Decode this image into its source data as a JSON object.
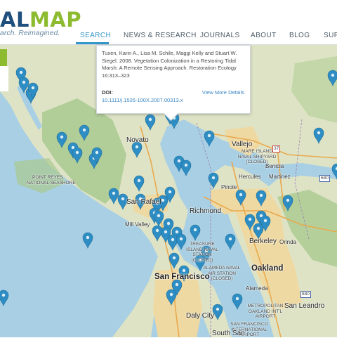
{
  "logo": {
    "text_dark": "AL",
    "text_accent": "MAP",
    "tagline": "arch. Reimagined."
  },
  "nav": {
    "search": "SEARCH",
    "news": "NEWS & RESEARCH",
    "journals": "JOURNALS",
    "about": "ABOUT",
    "blog": "BLOG",
    "support": "SUPP"
  },
  "popup": {
    "citation": "Tuxen, Karin A., Lisa M. Schile, Maggi Kelly and Stuart W. Siegel. 2008. Vegetation Colonization in a Restoring Tidal Marsh: A Remote Sensing Approach. Restoration Ecology 16:313–323",
    "doi_label": "DOI:",
    "doi": "10.1111/j.1526-100X.2007.00313.x",
    "more": "View More Details"
  },
  "map": {
    "labels": {
      "novato": "Novato",
      "vallejo": "Vallejo",
      "san_rafael": "San Rafael",
      "richmond": "Richmond",
      "mill_valley": "Mill Valley",
      "hercules": "Hercules",
      "martinez": "Martinez",
      "benicia": "Benicia",
      "pinole": "Pinole",
      "berkeley": "Berkeley",
      "orinda": "Orinda",
      "oakland": "Oakland",
      "san_francisco": "San Francisco",
      "daly_city": "Daly City",
      "south_san": "South San",
      "san_leandro": "San Leandro",
      "alameda": "Alameda",
      "point_reyes": "POINT REYES",
      "national_seashore": "NATIONAL SEASHORE",
      "mare_island": "MARE ISLAND NAVAL SHIPYARD (CLOSED)",
      "treasure_island": "TREASURE ISLAND NAVAL STATION (CLOSED)",
      "alameda_nas": "ALAMEDA NAVAL AIR STATION (CLOSED)",
      "oakland_airport": "METROPOLITAN OAKLAND INT'L AIRPORT",
      "sf_airport": "SAN FRANCISCO INTERNATIONAL AIRPORT",
      "route_37": "37",
      "route_680": "680",
      "route_880": "880"
    },
    "marker_icon": "map-pin-icon",
    "colors": {
      "ocean": "#a8cfe3",
      "land": "#dfe3c6",
      "green": "#a9c98f",
      "urban": "#efd9a2",
      "marker": "#2e8ec4",
      "accent": "#8dbb2f",
      "brand": "#1f4f7c"
    }
  }
}
